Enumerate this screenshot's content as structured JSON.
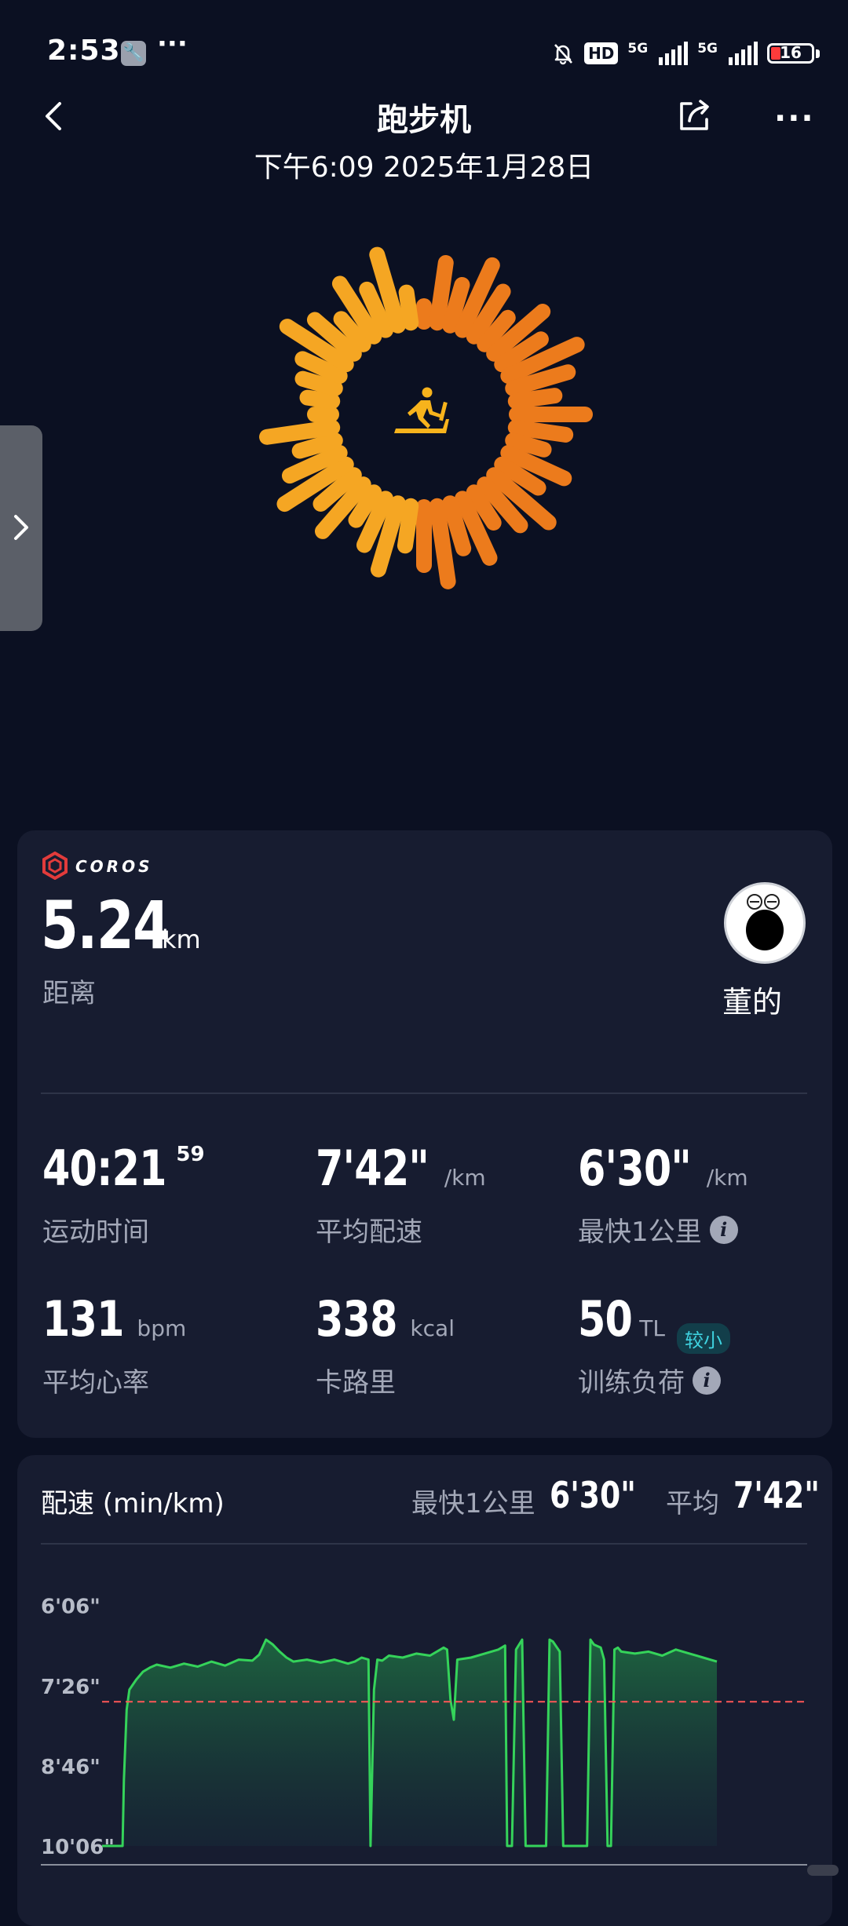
{
  "status_bar": {
    "time": "2:53",
    "more": "···",
    "hd": "HD",
    "net1": "5G",
    "net2": "5G",
    "battery": "16"
  },
  "header": {
    "title": "跑步机",
    "subtitle": "下午6:09 2025年1月28日",
    "more": "···"
  },
  "brand": {
    "name": "COROS"
  },
  "summary": {
    "distance_value": "5.24",
    "distance_unit": "km",
    "distance_label": "距离",
    "owner_name": "董的"
  },
  "stats": {
    "time_value": "40:21",
    "time_sup": "59",
    "time_label": "运动时间",
    "avg_pace_value": "7'42\"",
    "avg_pace_unit": "/km",
    "avg_pace_label": "平均配速",
    "best_km_value": "6'30\"",
    "best_km_unit": "/km",
    "best_km_label": "最快1公里",
    "hr_value": "131",
    "hr_unit": "bpm",
    "hr_label": "平均心率",
    "cal_value": "338",
    "cal_unit": "kcal",
    "cal_label": "卡路里",
    "load_value": "50",
    "load_unit": "TL",
    "load_badge": "较小",
    "load_label": "训练负荷",
    "info_glyph": "i"
  },
  "pace_card": {
    "title": "配速 (min/km)",
    "best_label": "最快1公里",
    "best_value": "6'30\"",
    "avg_label": "平均",
    "avg_value": "7'42\""
  },
  "chart_data": {
    "type": "area",
    "y_axis_reversed": true,
    "ytick_labels": [
      "6'06\"",
      "7'26\"",
      "8'46\"",
      "10'06\""
    ],
    "y_ticks_seconds": [
      366,
      446,
      526,
      606
    ],
    "ylim_seconds": [
      360,
      606
    ],
    "average_line_seconds": 462,
    "xlim": [
      0,
      100
    ],
    "x": [
      0,
      2,
      3,
      3.2,
      3.6,
      4,
      5,
      6,
      7,
      8,
      10,
      12,
      14,
      16,
      18,
      20,
      22,
      23,
      24,
      25,
      26,
      27,
      28,
      30,
      32,
      34,
      36,
      37,
      38,
      39,
      39.3,
      39.8,
      40.3,
      41,
      42,
      44,
      46,
      48,
      49,
      50,
      50.5,
      51,
      51.5,
      52,
      54,
      56,
      58,
      59,
      59.3,
      59.6,
      60,
      60.6,
      61.5,
      62,
      62.5,
      65,
      65.5,
      66,
      67,
      67.5,
      68,
      71,
      71.5,
      72,
      73,
      73.5,
      74,
      74.5,
      75,
      75.5,
      76,
      78,
      80,
      82,
      84,
      86,
      88,
      89,
      90
    ],
    "values": [
      606,
      606,
      606,
      540,
      470,
      450,
      440,
      432,
      428,
      425,
      428,
      424,
      427,
      422,
      426,
      420,
      421,
      415,
      400,
      405,
      412,
      418,
      422,
      420,
      423,
      420,
      424,
      422,
      418,
      420,
      606,
      450,
      420,
      421,
      416,
      418,
      414,
      416,
      412,
      408,
      410,
      460,
      480,
      420,
      418,
      414,
      410,
      406,
      606,
      606,
      606,
      410,
      400,
      606,
      606,
      606,
      400,
      402,
      412,
      606,
      606,
      606,
      400,
      405,
      408,
      420,
      606,
      606,
      410,
      408,
      412,
      414,
      412,
      416,
      410,
      414,
      418,
      420,
      422
    ]
  },
  "colors": {
    "background": "#0b1022",
    "card": "#171c30",
    "ring_start": "#f7b31c",
    "ring_end": "#e8641a",
    "pace_line": "#35d35a",
    "avg_line": "#ff5757",
    "accent_badge": "#3fd3e0"
  },
  "icons": {
    "back": "chevron-left-icon",
    "share": "share-icon",
    "more": "more-icon",
    "activity": "treadmill-icon",
    "sidebar": "chevron-right-icon",
    "info": "info-icon"
  }
}
